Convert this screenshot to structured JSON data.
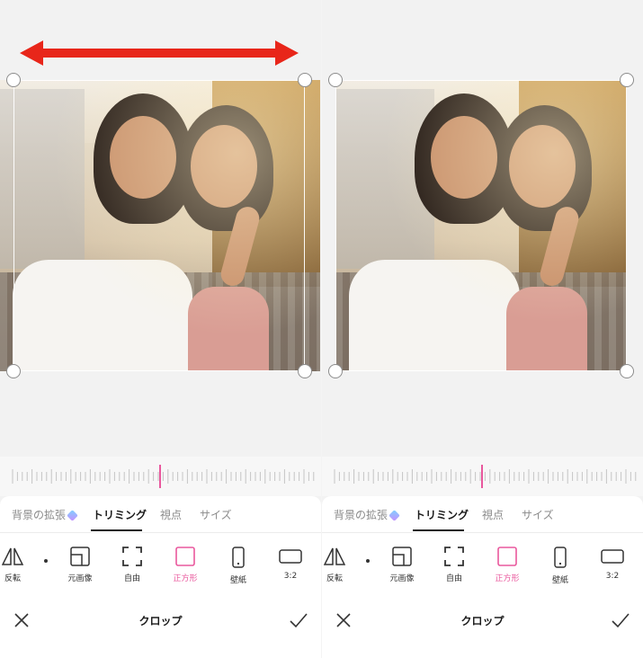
{
  "colors": {
    "accent": "#e9589d",
    "arrow": "#e8261a",
    "text": "#1a1a1a",
    "muted": "#8a8a8a"
  },
  "panels": [
    {
      "tabs": [
        {
          "label": "背景の拡張",
          "icon": "diamond-icon"
        },
        {
          "label": "トリミング",
          "active": true
        },
        {
          "label": "視点"
        },
        {
          "label": "サイズ"
        }
      ],
      "tools": [
        {
          "label": "反転",
          "icon": "flip-icon"
        },
        {
          "label": "元画像",
          "icon": "original-image-icon"
        },
        {
          "label": "自由",
          "icon": "free-crop-icon"
        },
        {
          "label": "正方形",
          "icon": "square-icon",
          "active": true
        },
        {
          "label": "壁紙",
          "icon": "phone-wallpaper-icon"
        },
        {
          "label": "3:2",
          "icon": "ratio-3-2-icon"
        }
      ],
      "bottom_title": "クロップ"
    },
    {
      "tabs": [
        {
          "label": "背景の拡張",
          "icon": "diamond-icon"
        },
        {
          "label": "トリミング",
          "active": true
        },
        {
          "label": "視点"
        },
        {
          "label": "サイズ"
        }
      ],
      "tools": [
        {
          "label": "反転",
          "icon": "flip-icon"
        },
        {
          "label": "元画像",
          "icon": "original-image-icon"
        },
        {
          "label": "自由",
          "icon": "free-crop-icon"
        },
        {
          "label": "正方形",
          "icon": "square-icon",
          "active": true
        },
        {
          "label": "壁紙",
          "icon": "phone-wallpaper-icon"
        },
        {
          "label": "3:2",
          "icon": "ratio-3-2-icon"
        }
      ],
      "bottom_title": "クロップ"
    }
  ]
}
